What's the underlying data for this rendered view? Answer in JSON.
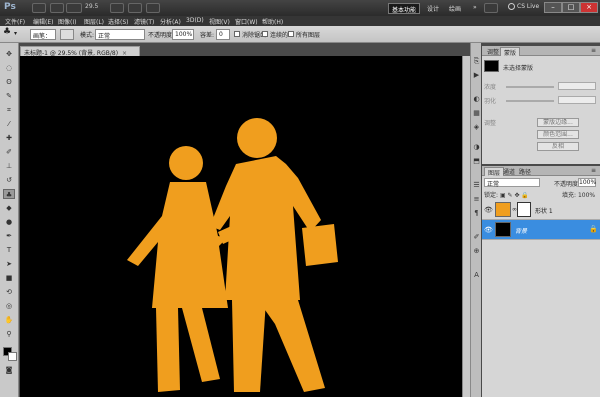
{
  "app": {
    "logo": "Ps",
    "zoom": "29.5",
    "workspace_active": "基本功能",
    "ws2": "设计",
    "ws3": "绘画",
    "more": "»",
    "cslive": "CS Live"
  },
  "menu": [
    "文件(F)",
    "编辑(E)",
    "图像(I)",
    "图层(L)",
    "选择(S)",
    "滤镜(T)",
    "分析(A)",
    "3D(D)",
    "视图(V)",
    "窗口(W)",
    "帮助(H)"
  ],
  "options": {
    "brush_label": "画笔：",
    "mode_label": "模式:",
    "mode_value": "正常",
    "opacity_label": "不透明度:",
    "opacity_value": "100%",
    "tolerance_label": "容差:",
    "tolerance_value": "0",
    "antialias": "消除锯齿",
    "contiguous": "连续的",
    "all_layers": "所有图层"
  },
  "document": {
    "tab": "未标题-1 @ 29.5% (背景, RGB/8)",
    "close": "×"
  },
  "adjust_panel": {
    "tab1": "调整",
    "tab2": "蒙版",
    "mask_name": "未选择蒙版",
    "row1": "浓度",
    "row2": "羽化",
    "row3": "调整",
    "btn1": "蒙版边缘...",
    "btn2": "颜色范围...",
    "btn3": "反相"
  },
  "layers_panel": {
    "tab1": "图层",
    "tab2": "通道",
    "tab3": "路径",
    "blend_mode": "正常",
    "opacity_label": "不透明度:",
    "opacity_value": "100%",
    "lock_label": "锁定:",
    "fill_label": "填充:",
    "fill_value": "100%",
    "layers": [
      {
        "name": "形状 1",
        "selected": false
      },
      {
        "name": "背景",
        "selected": true
      }
    ]
  },
  "colors": {
    "figure": "#F09E1E",
    "canvas": "#000000",
    "selection": "#3A8DE0"
  }
}
